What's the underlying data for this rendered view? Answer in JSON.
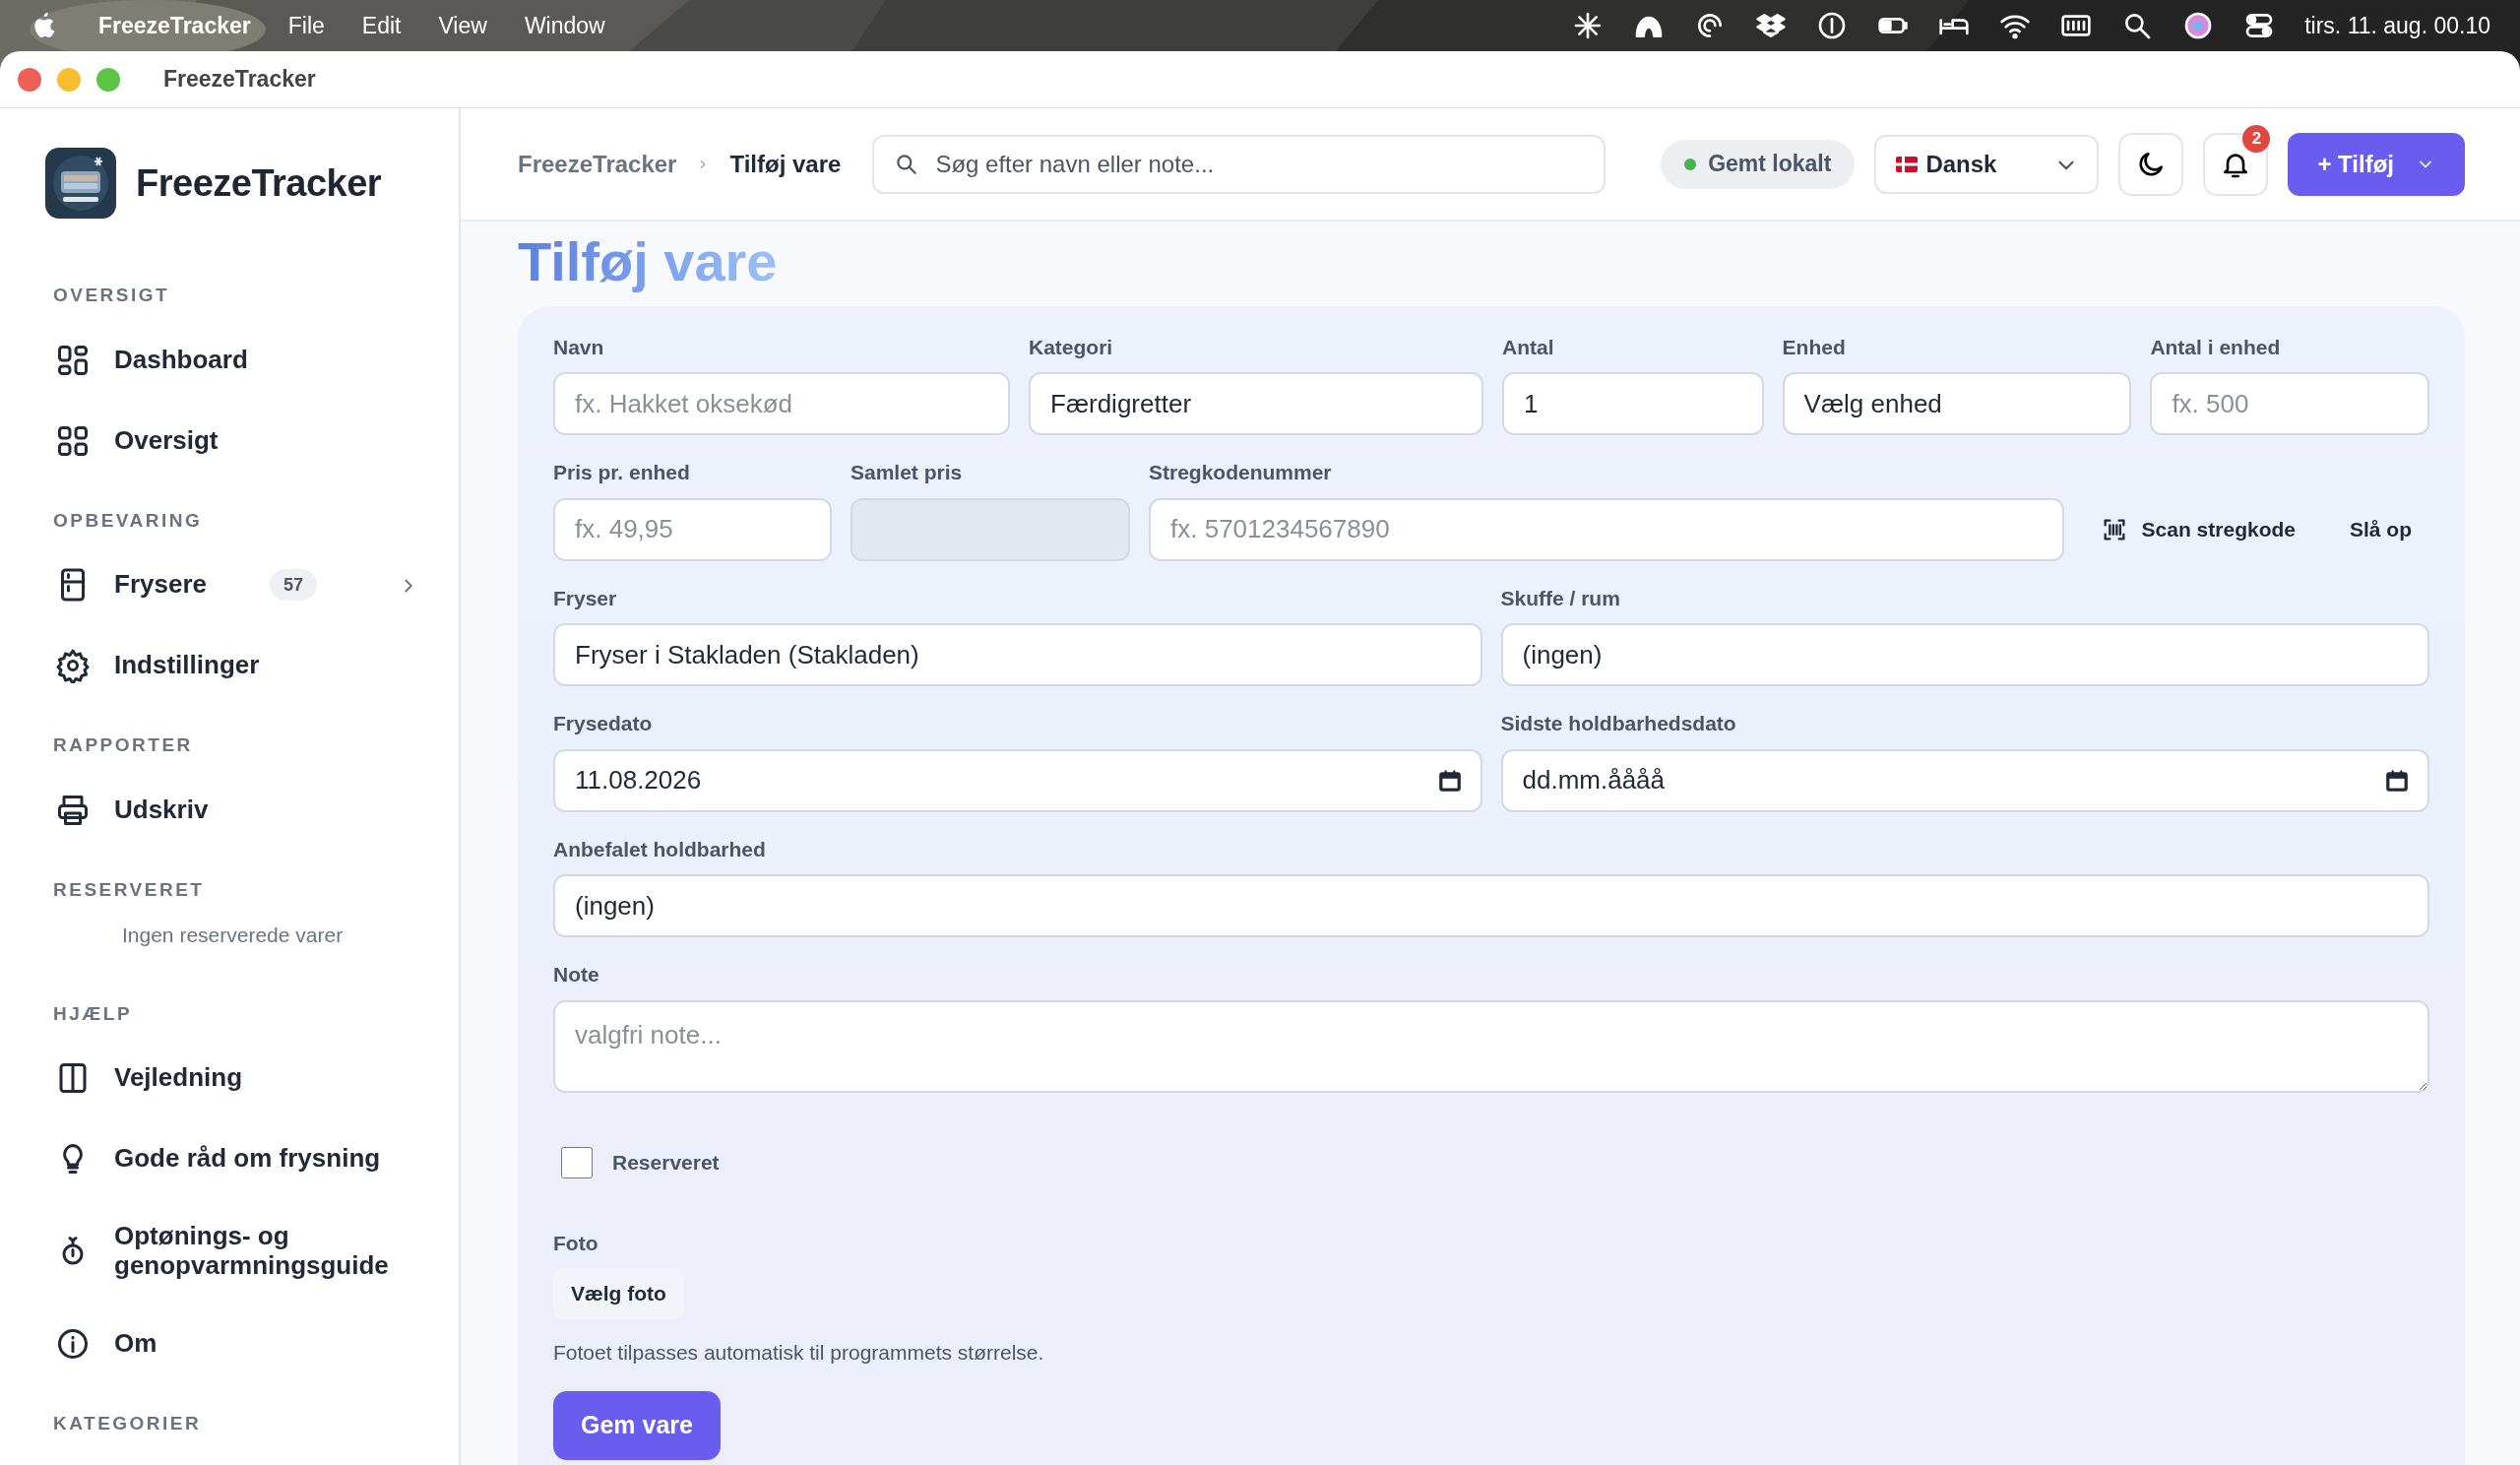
{
  "menubar": {
    "app": "FreezeTracker",
    "menus": [
      "File",
      "Edit",
      "View",
      "Window"
    ],
    "clock": "tirs. 11. aug.  00.10"
  },
  "window": {
    "title": "FreezeTracker"
  },
  "sidebar": {
    "brand": "FreezeTracker",
    "sections": [
      {
        "title": "OVERSIGT",
        "items": [
          {
            "label": "Dashboard",
            "selected": false
          },
          {
            "label": "Oversigt",
            "selected": false
          }
        ]
      },
      {
        "title": "OPBEVARING",
        "items": [
          {
            "label": "Frysere",
            "badge": "57",
            "expandable": true,
            "selected": false
          },
          {
            "label": "Indstillinger",
            "selected": false
          }
        ]
      },
      {
        "title": "RAPPORTER",
        "items": [
          {
            "label": "Udskriv",
            "selected": false
          }
        ]
      },
      {
        "title": "RESERVERET",
        "empty_text": "Ingen reserverede varer"
      },
      {
        "title": "HJÆLP",
        "items": [
          {
            "label": "Vejledning",
            "selected": false
          },
          {
            "label": "Gode råd om frysning",
            "selected": false
          },
          {
            "label": "Optønings- og genopvarmningsguide",
            "selected": false
          },
          {
            "label": "Om",
            "selected": false
          }
        ]
      },
      {
        "title": "KATEGORIER"
      }
    ]
  },
  "header": {
    "breadcrumb": [
      "FreezeTracker",
      "Tilføj vare"
    ],
    "search": {
      "placeholder": "Søg efter navn eller note..."
    },
    "status": {
      "label": "Gemt lokalt",
      "color": "#4caf50"
    },
    "language": "Dansk",
    "notifications": "2",
    "add_button": "+ Tilføj"
  },
  "page_title": "Tilføj vare",
  "form": {
    "groups": [
      {
        "fields": [
          {
            "label": "Navn",
            "kind": "text",
            "placeholder": "fx. Hakket oksekød"
          },
          {
            "label": "Kategori",
            "kind": "select",
            "value": "Færdigretter"
          },
          {
            "label": "Antal",
            "kind": "text",
            "value": "1"
          },
          {
            "label": "Enhed",
            "kind": "select",
            "value": "Vælg enhed"
          },
          {
            "label": "Antal i enhed",
            "kind": "text",
            "placeholder": "fx. 500"
          }
        ]
      },
      {
        "fields": [
          {
            "label": "Pris pr. enhed",
            "kind": "text",
            "placeholder": "fx. 49,95"
          },
          {
            "label": "Samlet pris",
            "kind": "text",
            "disabled": true
          },
          {
            "label": "Stregkodenummer",
            "kind": "text",
            "placeholder": "fx. 5701234567890"
          },
          {
            "kind": "scan",
            "label": "Scan stregkode"
          },
          {
            "kind": "link",
            "label": "Slå op"
          }
        ]
      },
      {
        "fields": [
          {
            "label": "Fryser",
            "kind": "select",
            "value": "Fryser i Stakladen (Stakladen)"
          },
          {
            "label": "Skuffe / rum",
            "kind": "select",
            "value": "(ingen)"
          }
        ]
      },
      {
        "fields": [
          {
            "label": "Frysedato",
            "kind": "date",
            "value": "11.08.2026"
          },
          {
            "label": "Sidste holdbarhedsdato",
            "kind": "date",
            "placeholder": "dd.mm.åååå"
          }
        ]
      },
      {
        "fields": [
          {
            "label": "Anbefalet holdbarhed",
            "kind": "select",
            "value": "(ingen)"
          }
        ]
      },
      {
        "fields": [
          {
            "label": "Note",
            "kind": "textarea",
            "placeholder": "valgfri note..."
          }
        ]
      }
    ],
    "reserved": {
      "label": "Reserveret",
      "checked": false
    },
    "photo": {
      "label": "Foto",
      "button": "Vælg foto",
      "hint": "Fotoet tilpasses automatisk til programmets størrelse."
    },
    "submit": "Gem vare"
  }
}
